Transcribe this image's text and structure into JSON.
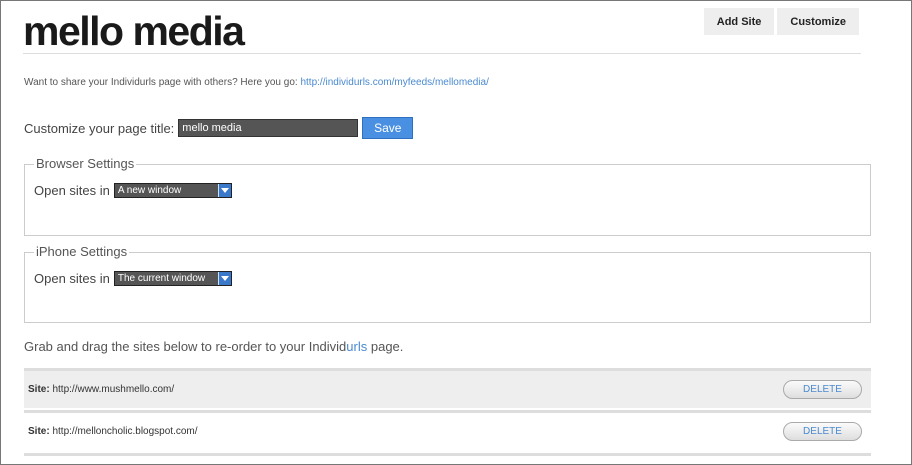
{
  "page": {
    "title": "mello media"
  },
  "toolbar": {
    "add_site_label": "Add Site",
    "customize_label": "Customize"
  },
  "share": {
    "text": "Want to share your Individurls page with others? Here you go:",
    "link": "http://individurls.com/myfeeds/mellomedia/"
  },
  "customize_title": {
    "label": "Customize your page title:",
    "value": "mello media",
    "save_label": "Save"
  },
  "browser_settings": {
    "legend": "Browser Settings",
    "label": "Open sites in",
    "selected": "A new window"
  },
  "iphone_settings": {
    "legend": "iPhone Settings",
    "label": "Open sites in",
    "selected": "The current window"
  },
  "drag_note": {
    "before": "Grab and drag the sites below to re-order to your Individ",
    "brand": "urls",
    "after": " page."
  },
  "sites": [
    {
      "label": "Site:",
      "url": "http://www.mushmello.com/",
      "delete_label": "DELETE"
    },
    {
      "label": "Site:",
      "url": "http://melloncholic.blogspot.com/",
      "delete_label": "DELETE"
    }
  ],
  "colors": {
    "accent": "#4a90e2",
    "link": "#4a8ad0",
    "input_bg": "#555555"
  }
}
